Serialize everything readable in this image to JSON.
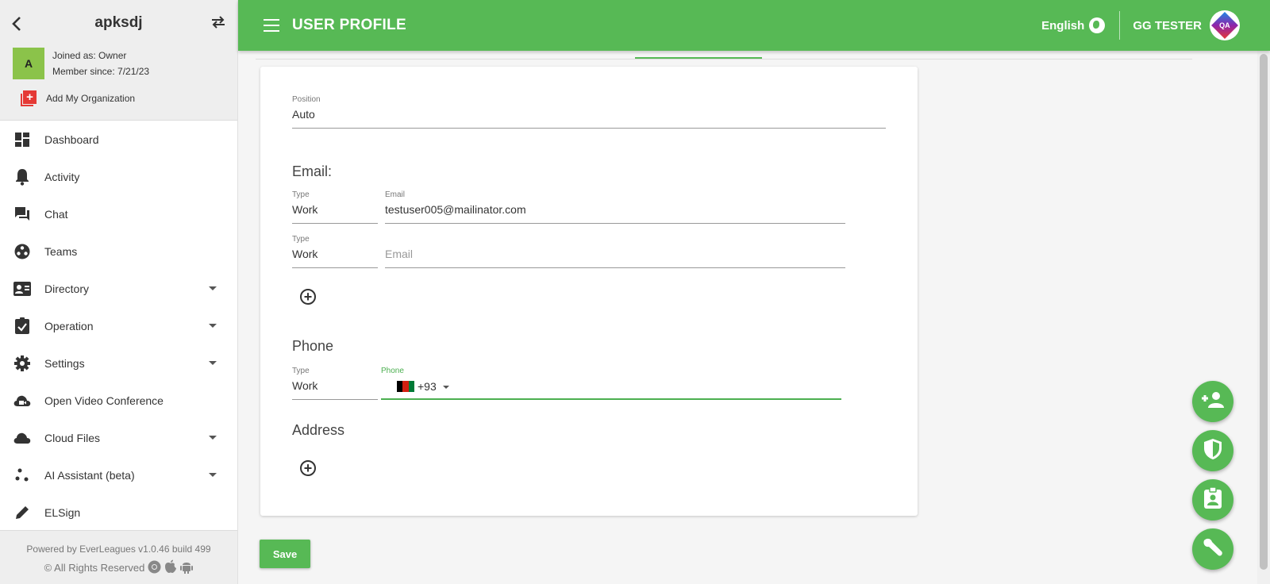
{
  "sidebar": {
    "org_name": "apksdj",
    "avatar_letter": "A",
    "joined": "Joined as: Owner",
    "member_since": "Member since: 7/21/23",
    "add_org": "Add My Organization",
    "items": [
      {
        "label": "Dashboard",
        "icon": "dashboard-icon",
        "expandable": false
      },
      {
        "label": "Activity",
        "icon": "bell-icon",
        "expandable": false
      },
      {
        "label": "Chat",
        "icon": "chat-icon",
        "expandable": false
      },
      {
        "label": "Teams",
        "icon": "teams-icon",
        "expandable": false
      },
      {
        "label": "Directory",
        "icon": "contact-card-icon",
        "expandable": true
      },
      {
        "label": "Operation",
        "icon": "clipboard-check-icon",
        "expandable": true
      },
      {
        "label": "Settings",
        "icon": "gear-icon",
        "expandable": true
      },
      {
        "label": "Open Video Conference",
        "icon": "video-cloud-icon",
        "expandable": false
      },
      {
        "label": "Cloud Files",
        "icon": "cloud-icon",
        "expandable": true
      },
      {
        "label": "AI Assistant (beta)",
        "icon": "ai-dots-icon",
        "expandable": true
      },
      {
        "label": "ELSign",
        "icon": "pen-icon",
        "expandable": false
      }
    ],
    "footer_powered": "Powered by EverLeagues v1.0.46 build 499",
    "footer_rights": "© All Rights Reserved"
  },
  "header": {
    "title": "USER PROFILE",
    "language": "English",
    "user_name": "GG TESTER",
    "avatar_text": "QA"
  },
  "form": {
    "position": {
      "label": "Position",
      "value": "Auto"
    },
    "email_title": "Email:",
    "email_rows": [
      {
        "type_label": "Type",
        "type_value": "Work",
        "email_label": "Email",
        "email_value": "testuser005@mailinator.com"
      },
      {
        "type_label": "Type",
        "type_value": "Work",
        "email_label": "",
        "email_placeholder": "Email"
      }
    ],
    "phone_title": "Phone",
    "phone": {
      "type_label": "Type",
      "type_value": "Work",
      "phone_label": "Phone",
      "country_code": "+93"
    },
    "address_title": "Address",
    "save_label": "Save"
  },
  "colors": {
    "accent": "#57b955",
    "danger": "#e53935"
  }
}
